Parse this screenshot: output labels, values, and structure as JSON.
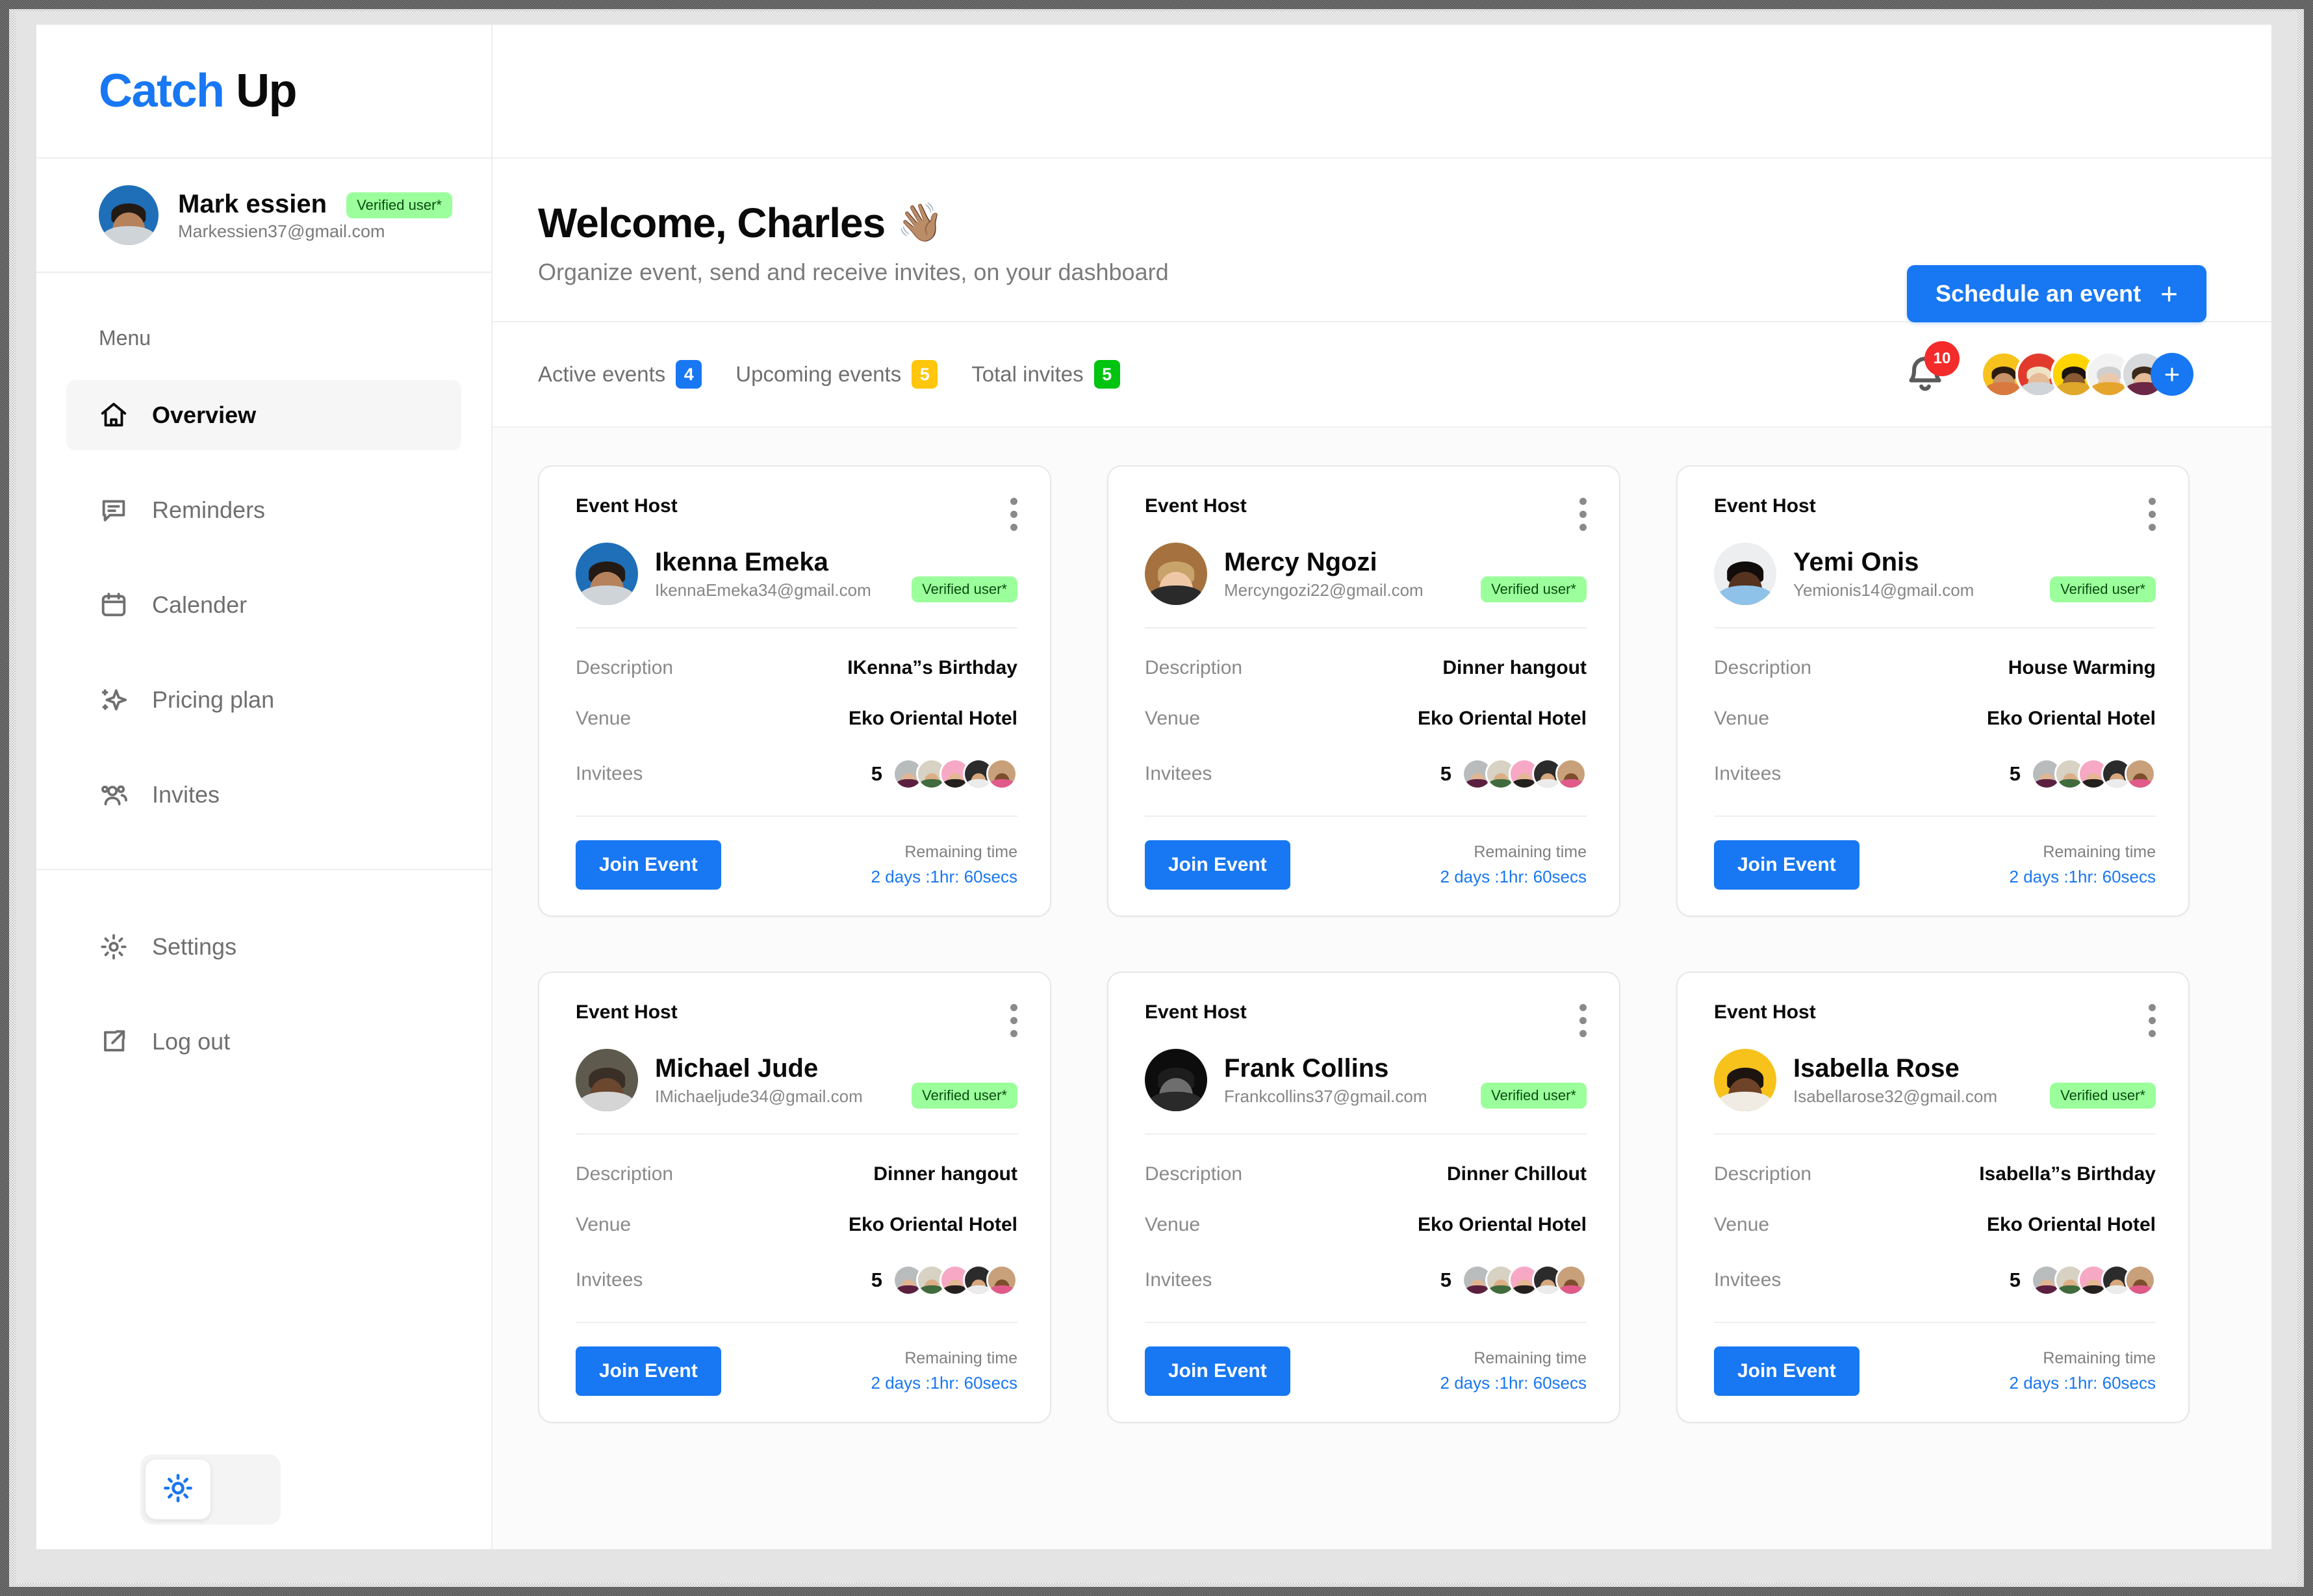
{
  "brand": {
    "part1": "Catch",
    "part2": "Up"
  },
  "profile": {
    "name": "Mark essien",
    "email": "Markessien37@gmail.com",
    "verified_label": "Verified user*",
    "avatar": "user-avatar-mark-essien"
  },
  "sidebar": {
    "menu_label": "Menu",
    "items": [
      {
        "label": "Overview",
        "icon": "home-icon",
        "active": true
      },
      {
        "label": "Reminders",
        "icon": "chat-bubble-icon",
        "active": false
      },
      {
        "label": "Calender",
        "icon": "calendar-icon",
        "active": false
      },
      {
        "label": "Pricing plan",
        "icon": "sparkle-icon",
        "active": false
      },
      {
        "label": "Invites",
        "icon": "people-icon",
        "active": false
      }
    ],
    "footer_items": [
      {
        "label": "Settings",
        "icon": "gear-icon"
      },
      {
        "label": "Log out",
        "icon": "external-link-icon"
      }
    ],
    "theme_toggle": {
      "icon": "sun-icon",
      "mode": "light"
    }
  },
  "header": {
    "title": "Welcome, Charles",
    "wave_emoji": "👋🏽",
    "subtitle": "Organize event, send and receive invites, on your dashboard",
    "cta": {
      "label": "Schedule an event",
      "icon": "plus-icon"
    }
  },
  "stats": [
    {
      "label": "Active events",
      "value": "4",
      "color": "#1877F2"
    },
    {
      "label": "Upcoming events",
      "value": "5",
      "color": "#FFC60B"
    },
    {
      "label": "Total invites",
      "value": "5",
      "color": "#00C40F"
    }
  ],
  "notifications": {
    "icon": "bell-icon",
    "count": "10",
    "badge_color": "#F42B2B"
  },
  "member_stack": {
    "add_label": "+",
    "members": [
      "member-avatar-1",
      "member-avatar-2",
      "member-avatar-3",
      "member-avatar-4",
      "member-avatar-5"
    ]
  },
  "card_labels": {
    "host": "Event Host",
    "description": "Description",
    "venue": "Venue",
    "invitees": "Invitees",
    "join": "Join Event",
    "remaining_time": "Remaining time",
    "menu_icon": "kebab-menu-icon",
    "verified": "Verified user*"
  },
  "events": [
    {
      "host_name": "Ikenna Emeka",
      "host_email": "IkennaEmeka34@gmail.com",
      "verified": "Verified user*",
      "description": "IKenna”s Birthday",
      "venue": "Eko Oriental Hotel",
      "invitees_count": "5",
      "join": "Join Event",
      "remaining_label": "Remaining time",
      "remaining_value": "2 days :1hr: 60secs"
    },
    {
      "host_name": "Mercy Ngozi",
      "host_email": "Mercyngozi22@gmail.com",
      "verified": "Verified user*",
      "description": "Dinner hangout",
      "venue": "Eko Oriental Hotel",
      "invitees_count": "5",
      "join": "Join Event",
      "remaining_label": "Remaining time",
      "remaining_value": "2 days :1hr: 60secs"
    },
    {
      "host_name": "Yemi Onis",
      "host_email": "Yemionis14@gmail.com",
      "verified": "Verified user*",
      "description": "House Warming",
      "venue": "Eko Oriental Hotel",
      "invitees_count": "5",
      "join": "Join Event",
      "remaining_label": "Remaining time",
      "remaining_value": "2 days :1hr: 60secs"
    },
    {
      "host_name": "Michael Jude",
      "host_email": "IMichaeljude34@gmail.com",
      "verified": "Verified user*",
      "description": "Dinner hangout",
      "venue": "Eko Oriental Hotel",
      "invitees_count": "5",
      "join": "Join Event",
      "remaining_label": "Remaining time",
      "remaining_value": "2 days :1hr: 60secs"
    },
    {
      "host_name": "Frank Collins",
      "host_email": "Frankcollins37@gmail.com",
      "verified": "Verified user*",
      "description": "Dinner Chillout",
      "venue": "Eko Oriental Hotel",
      "invitees_count": "5",
      "join": "Join Event",
      "remaining_label": "Remaining time",
      "remaining_value": "2 days :1hr: 60secs"
    },
    {
      "host_name": "Isabella Rose",
      "host_email": "Isabellarose32@gmail.com",
      "verified": "Verified user*",
      "description": "Isabella”s Birthday",
      "venue": "Eko Oriental Hotel",
      "invitees_count": "5",
      "join": "Join Event",
      "remaining_label": "Remaining time",
      "remaining_value": "2 days :1hr: 60secs"
    }
  ],
  "colors": {
    "brand_blue": "#1877F2",
    "verified_green": "#9BFF9B",
    "badge_yellow": "#FFC60B",
    "badge_green": "#00C40F",
    "badge_red": "#F42B2B"
  }
}
